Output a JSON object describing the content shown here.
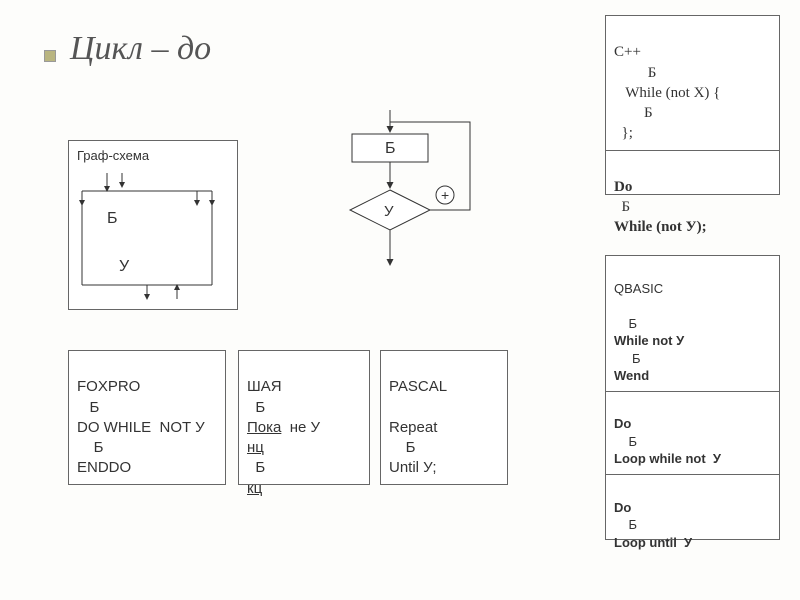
{
  "title": "Цикл – до",
  "graf": {
    "label": "Граф-схема",
    "b": "Б",
    "u": "У"
  },
  "flow": {
    "b": "Б",
    "u": "У",
    "plus": "+"
  },
  "foxpro": {
    "name": "FOXPRO",
    "l1": "   Б",
    "l2": "DO WHILE  NOT У",
    "l3": "    Б",
    "l4": "ENDDO"
  },
  "shaya": {
    "name": "ШАЯ",
    "l1": "  Б",
    "l2_a": "Пока",
    "l2_b": "  не У",
    "l3": "нц",
    "l4": "  Б",
    "l5": "кц"
  },
  "pascal": {
    "name": "PASCAL",
    "l1": "",
    "l2": "Repeat",
    "l3": "    Б",
    "l4": "Until У;"
  },
  "cpp": {
    "name": "С++",
    "a1": "         Б",
    "a2": "   While (not X) {",
    "a3": "        Б",
    "a4": "  };",
    "b1": "Do",
    "b2": "  Б",
    "b3": "While (not У);"
  },
  "qbasic": {
    "name": "QBASIC",
    "a0": "",
    "a1": "    Б",
    "a2": "While not У",
    "a3": "     Б",
    "a4": "Wend",
    "b1": "Do",
    "b2": "    Б",
    "b3": "Loop while not  У",
    "c1": "Do",
    "c2": "    Б",
    "c3": "Loop until  У"
  }
}
